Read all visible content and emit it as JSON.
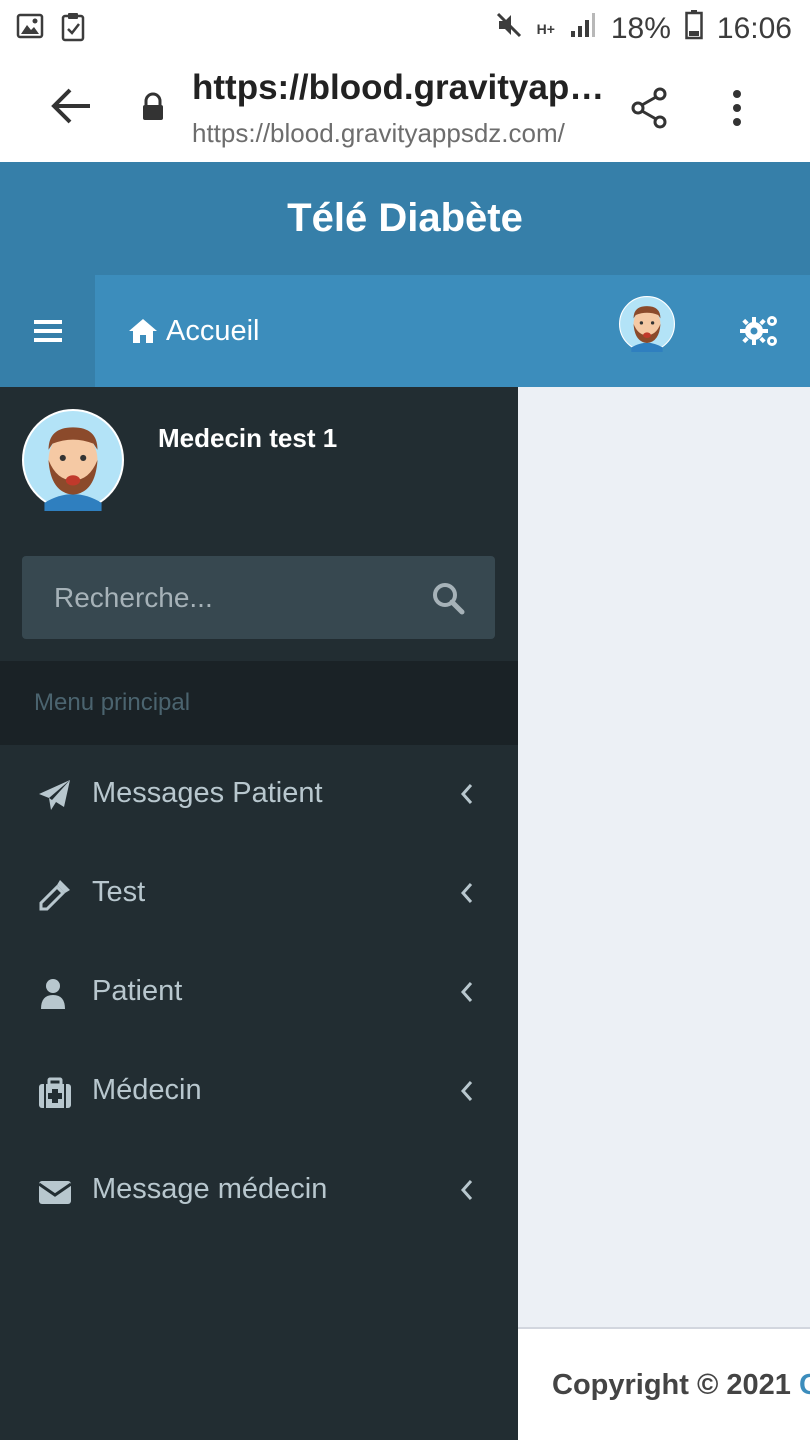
{
  "status_bar": {
    "network": "H+",
    "battery": "18%",
    "time": "16:06"
  },
  "browser": {
    "title": "https://blood.gravityappsdz.com/",
    "url": "https://blood.gravityappsdz.com/"
  },
  "app": {
    "title": "Télé Diabète",
    "accent_color": "#3c8dbc",
    "header_color": "#367fa9",
    "sidebar_color": "#222d32"
  },
  "navbar": {
    "home_label": "Accueil"
  },
  "sidebar": {
    "user_name": "Medecin test 1",
    "search_placeholder": "Recherche...",
    "menu_header": "Menu principal",
    "items": [
      {
        "label": "Messages Patient",
        "icon": "paper-plane-icon"
      },
      {
        "label": "Test",
        "icon": "eyedropper-icon"
      },
      {
        "label": "Patient",
        "icon": "user-icon"
      },
      {
        "label": "Médecin",
        "icon": "medkit-icon"
      },
      {
        "label": "Message médecin",
        "icon": "envelope-icon"
      }
    ]
  },
  "footer": {
    "copyright_prefix": "Copyright © 2021",
    "copyright_accent": "C"
  }
}
